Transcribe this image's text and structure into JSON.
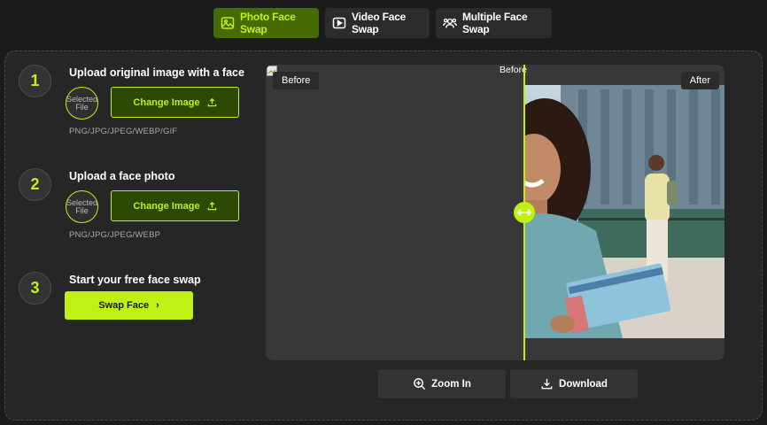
{
  "tabs": [
    {
      "label": "Photo Face Swap",
      "icon": "image-icon",
      "active": true
    },
    {
      "label": "Video Face Swap",
      "icon": "play-icon",
      "active": false
    },
    {
      "label": "Multiple Face Swap",
      "icon": "users-icon",
      "active": false
    }
  ],
  "steps": [
    {
      "number": "1",
      "title": "Upload original image with a face",
      "thumb_alt": "Selected File",
      "button": "Change Image",
      "formats": "PNG/JPG/JPEG/WEBP/GIF"
    },
    {
      "number": "2",
      "title": "Upload a face photo",
      "thumb_alt": "Selected File",
      "button": "Change Image",
      "formats": "PNG/JPG/JPEG/WEBP"
    },
    {
      "number": "3",
      "title": "Start your free face swap",
      "button": "Swap Face",
      "button_icon": "›"
    }
  ],
  "compare": {
    "before_label": "Before",
    "before_overlay_label": "Before",
    "after_label": "After"
  },
  "actions": {
    "zoom_label": "Zoom In",
    "download_label": "Download"
  },
  "colors": {
    "accent": "#bff214",
    "accent_dark": "#2d4a05",
    "panel": "#262626",
    "background": "#1b1b1b"
  }
}
